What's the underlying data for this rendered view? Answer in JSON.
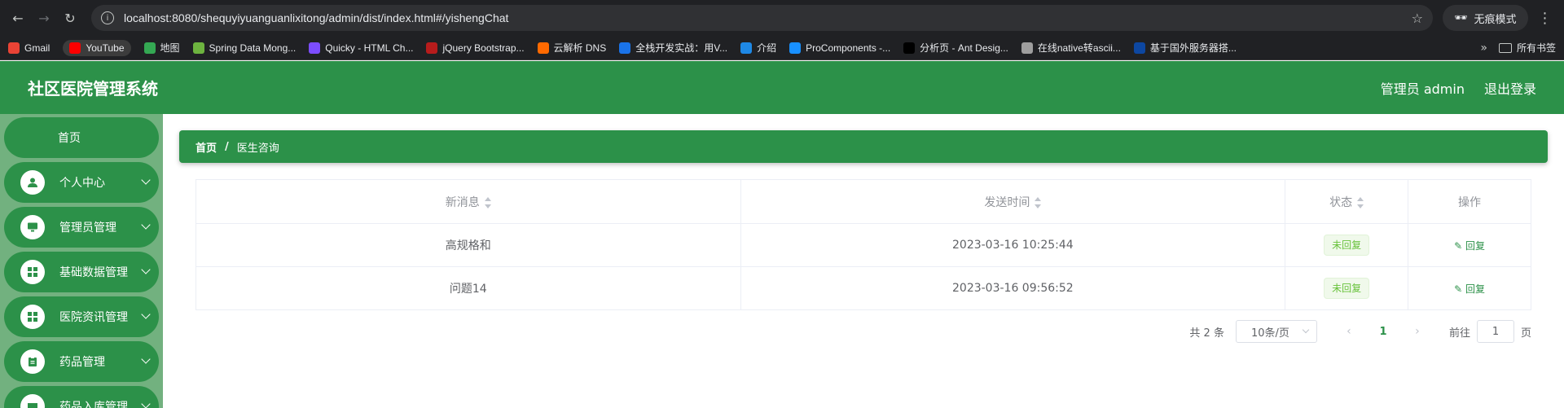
{
  "browser": {
    "url": "localhost:8080/shequyiyuanguanlixitong/admin/dist/index.html#/yishengChat",
    "incognito_label": "无痕模式",
    "bookmarks": [
      {
        "label": "Gmail",
        "color": "#ea4335"
      },
      {
        "label": "YouTube",
        "color": "#ff0000"
      },
      {
        "label": "地图",
        "color": "#34a853"
      },
      {
        "label": "Spring Data Mong...",
        "color": "#6db33f"
      },
      {
        "label": "Quicky - HTML Ch...",
        "color": "#7c4dff"
      },
      {
        "label": "jQuery Bootstrap...",
        "color": "#b71c1c"
      },
      {
        "label": "云解析 DNS",
        "color": "#ff6a00"
      },
      {
        "label": "全栈开发实战：用V...",
        "color": "#1a73e8"
      },
      {
        "label": "介绍",
        "color": "#1e88e5"
      },
      {
        "label": "ProComponents -...",
        "color": "#1890ff"
      },
      {
        "label": "分析页 - Ant Desig...",
        "color": "#000000"
      },
      {
        "label": "在线native转ascii...",
        "color": "#9e9e9e"
      },
      {
        "label": "基于国外服务器搭...",
        "color": "#0d47a1"
      }
    ],
    "all_bookmarks_label": "所有书签"
  },
  "header": {
    "title": "社区医院管理系统",
    "user": "管理员 admin",
    "logout": "退出登录"
  },
  "sidebar": {
    "items": [
      {
        "label": "首页"
      },
      {
        "label": "个人中心",
        "icon": "user-icon"
      },
      {
        "label": "管理员管理",
        "icon": "monitor-icon"
      },
      {
        "label": "基础数据管理",
        "icon": "grid-icon"
      },
      {
        "label": "医院资讯管理",
        "icon": "grid-icon"
      },
      {
        "label": "药品管理",
        "icon": "clipboard-icon"
      },
      {
        "label": "药品入库管理",
        "icon": "box-icon"
      }
    ]
  },
  "breadcrumb": {
    "home": "首页",
    "separator": "/",
    "current": "医生咨询"
  },
  "table": {
    "columns": [
      "新消息",
      "发送时间",
      "状态",
      "操作"
    ],
    "rows": [
      {
        "message": "高规格和",
        "time": "2023-03-16 10:25:44",
        "status": "未回复",
        "action": "回复"
      },
      {
        "message": "问题14",
        "time": "2023-03-16 09:56:52",
        "status": "未回复",
        "action": "回复"
      }
    ]
  },
  "pagination": {
    "total": "共 2 条",
    "page_size": "10条/页",
    "prev": "‹",
    "current_page": "1",
    "next": "›",
    "goto_label": "前往",
    "goto_value": "1",
    "page_label": "页"
  },
  "colors": {
    "primary": "#2c9149",
    "sidebar_bg": "#72b17f",
    "tag_green": "#67c23a"
  }
}
